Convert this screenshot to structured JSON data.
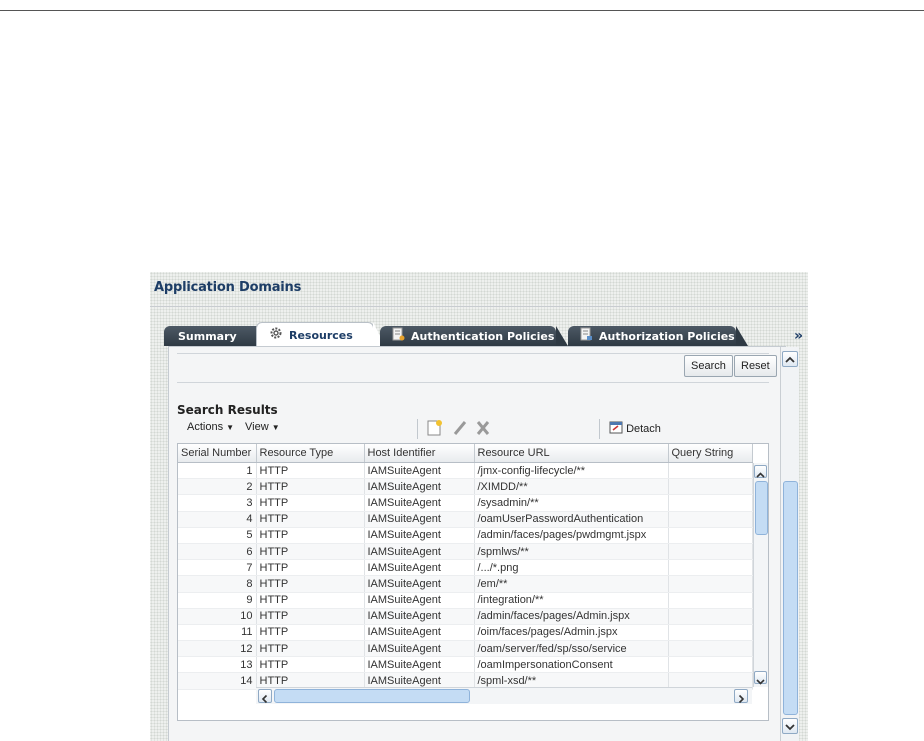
{
  "panel": {
    "title": "Application Domains"
  },
  "tabs": [
    {
      "label": "Summary",
      "icon": ""
    },
    {
      "label": "Resources",
      "icon": "gear-icon"
    },
    {
      "label": "Authentication Policies",
      "icon": "authentication-policy-icon"
    },
    {
      "label": "Authorization Policies",
      "icon": "authorization-policy-icon"
    }
  ],
  "tab_overflow": "»",
  "search": {
    "search_label": "Search",
    "reset_label": "Reset"
  },
  "results": {
    "title": "Search Results",
    "actions_label": "Actions",
    "view_label": "View",
    "detach_label": "Detach",
    "columns": [
      "Serial Number",
      "Resource Type",
      "Host Identifier",
      "Resource URL",
      "Query String"
    ],
    "rows": [
      {
        "serial": "1",
        "type": "HTTP",
        "host": "IAMSuiteAgent",
        "url": "/jmx-config-lifecycle/**",
        "query": ""
      },
      {
        "serial": "2",
        "type": "HTTP",
        "host": "IAMSuiteAgent",
        "url": "/XIMDD/**",
        "query": ""
      },
      {
        "serial": "3",
        "type": "HTTP",
        "host": "IAMSuiteAgent",
        "url": "/sysadmin/**",
        "query": ""
      },
      {
        "serial": "4",
        "type": "HTTP",
        "host": "IAMSuiteAgent",
        "url": "/oamUserPasswordAuthentication",
        "query": ""
      },
      {
        "serial": "5",
        "type": "HTTP",
        "host": "IAMSuiteAgent",
        "url": "/admin/faces/pages/pwdmgmt.jspx",
        "query": ""
      },
      {
        "serial": "6",
        "type": "HTTP",
        "host": "IAMSuiteAgent",
        "url": "/spmlws/**",
        "query": ""
      },
      {
        "serial": "7",
        "type": "HTTP",
        "host": "IAMSuiteAgent",
        "url": "/.../*.png",
        "query": ""
      },
      {
        "serial": "8",
        "type": "HTTP",
        "host": "IAMSuiteAgent",
        "url": "/em/**",
        "query": ""
      },
      {
        "serial": "9",
        "type": "HTTP",
        "host": "IAMSuiteAgent",
        "url": "/integration/**",
        "query": ""
      },
      {
        "serial": "10",
        "type": "HTTP",
        "host": "IAMSuiteAgent",
        "url": "/admin/faces/pages/Admin.jspx",
        "query": ""
      },
      {
        "serial": "11",
        "type": "HTTP",
        "host": "IAMSuiteAgent",
        "url": "/oim/faces/pages/Admin.jspx",
        "query": ""
      },
      {
        "serial": "12",
        "type": "HTTP",
        "host": "IAMSuiteAgent",
        "url": "/oam/server/fed/sp/sso/service",
        "query": ""
      },
      {
        "serial": "13",
        "type": "HTTP",
        "host": "IAMSuiteAgent",
        "url": "/oamImpersonationConsent",
        "query": ""
      },
      {
        "serial": "14",
        "type": "HTTP",
        "host": "IAMSuiteAgent",
        "url": "/spml-xsd/**",
        "query": ""
      }
    ]
  },
  "colors": {
    "title": "#1d3d66",
    "tab_dark": "#3a4653",
    "scroll_thumb": "#c4dcf4"
  }
}
